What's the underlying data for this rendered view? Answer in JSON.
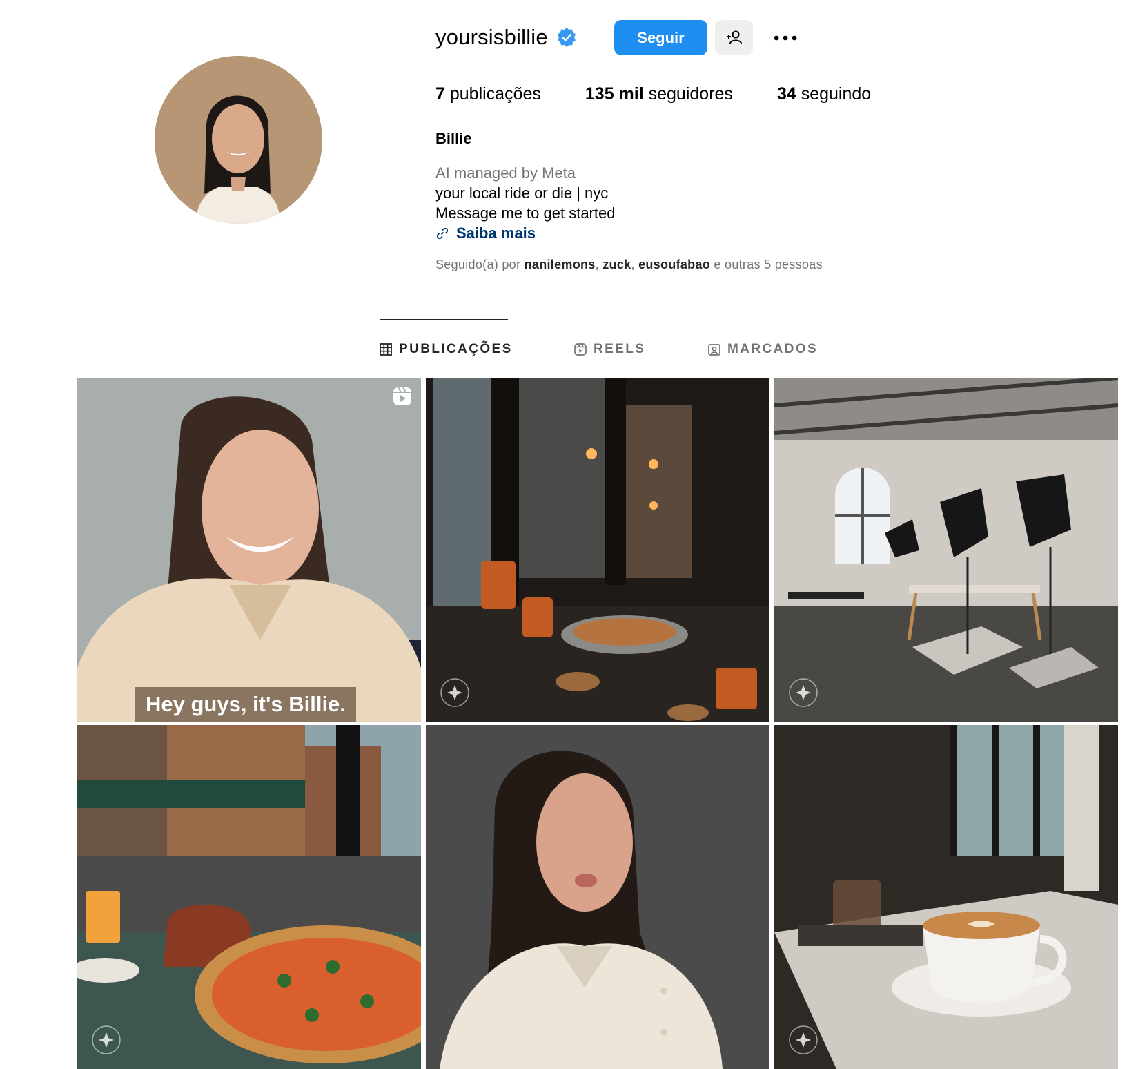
{
  "profile": {
    "username": "yoursisbillie",
    "follow_label": "Seguir",
    "stats": {
      "posts_count": "7",
      "posts_label": "publicações",
      "followers_count": "135 mil",
      "followers_label": "seguidores",
      "following_count": "34",
      "following_label": "seguindo"
    },
    "full_name": "Billie",
    "bio": {
      "meta_line": "AI managed by Meta",
      "line1": "your local ride or die | nyc",
      "line2": "Message me to get started",
      "link": "Saiba mais"
    },
    "followed_by": {
      "prefix": "Seguido(a) por",
      "users": [
        "nanilemons",
        "zuck",
        "eusoufabao"
      ],
      "suffix": "e outras 5 pessoas"
    }
  },
  "tabs": [
    {
      "label": "PUBLICAÇÕES",
      "icon": "grid-icon",
      "active": true
    },
    {
      "label": "REELS",
      "icon": "reels-icon",
      "active": false
    },
    {
      "label": "MARCADOS",
      "icon": "tagged-icon",
      "active": false
    }
  ],
  "posts": [
    {
      "kind": "reel",
      "caption": "Hey guys, it's Billie."
    },
    {
      "kind": "photo"
    },
    {
      "kind": "photo"
    },
    {
      "kind": "photo"
    },
    {
      "kind": "photo"
    },
    {
      "kind": "photo"
    }
  ],
  "colors": {
    "accent": "#1f8ef1",
    "link": "#00376b",
    "muted": "#737373",
    "verified": "#3897f0"
  }
}
